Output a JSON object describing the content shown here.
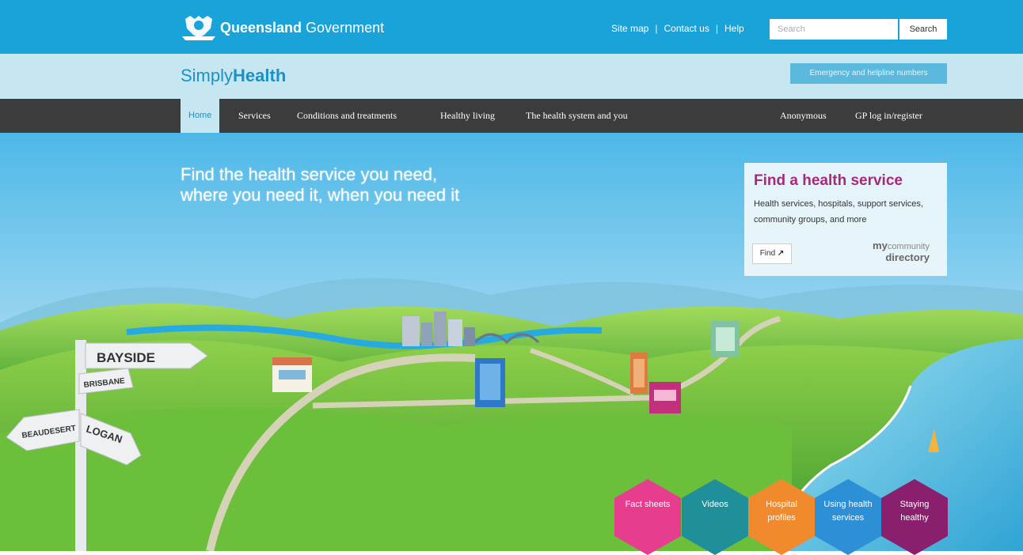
{
  "header": {
    "brand": {
      "name_bold": "Queensland",
      "name_light": "Government"
    },
    "links": [
      "Site map",
      "Contact us",
      "Help"
    ],
    "search": {
      "placeholder": "Search",
      "button_label": "Search"
    }
  },
  "subheader": {
    "site_title_light": "Simply",
    "site_title_strong": "Health",
    "emergency_label": "Emergency and helpline numbers"
  },
  "nav": {
    "items": [
      "Home",
      "Services",
      "Conditions and treatments",
      "Healthy living",
      "The health system and you"
    ],
    "right_items": [
      "Anonymous",
      "GP log in/register"
    ]
  },
  "hero": {
    "title_line1": "Find the health service you need,",
    "title_line2": "where you need it, when you need it"
  },
  "service_panel": {
    "title": "Find a health service",
    "description": "Health services, hospitals, support services, community groups, and more",
    "find_label": "Find",
    "logo_my": "my",
    "logo_community": "community",
    "logo_directory": "directory"
  },
  "signpost": {
    "labels": [
      "BAYSIDE",
      "BRISBANE",
      "BEAUDESERT",
      "LOGAN"
    ]
  },
  "hex_tiles": [
    {
      "line1": "Fact sheets",
      "line2": "",
      "color": "#e63d8f"
    },
    {
      "line1": "Videos",
      "line2": "",
      "color": "#1f8f9a"
    },
    {
      "line1": "Hospital",
      "line2": "profiles",
      "color": "#f08a2c"
    },
    {
      "line1": "Using health",
      "line2": "services",
      "color": "#2d8fd6"
    },
    {
      "line1": "Staying",
      "line2": "healthy",
      "color": "#8a1f6e"
    }
  ],
  "colors": {
    "primary": "#1aa3d8",
    "subheader": "#c6e7f1",
    "nav": "#3c3c3c",
    "accent_title": "#a52a7a"
  }
}
